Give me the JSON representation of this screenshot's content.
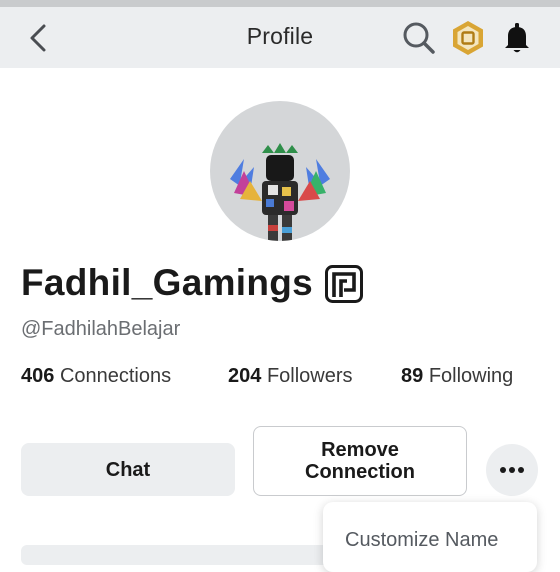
{
  "header": {
    "title": "Profile",
    "back_icon": "chevron-left-icon",
    "search_icon": "search-icon",
    "currency_icon": "robux-currency-icon",
    "notification_icon": "bell-icon"
  },
  "profile": {
    "display_name": "Fadhil_Gamings",
    "badge_icon": "verified-badge-icon",
    "username": "@FadhilahBelajar",
    "stats": [
      {
        "count": "406",
        "label": "Connections"
      },
      {
        "count": "204",
        "label": "Followers"
      },
      {
        "count": "89",
        "label": "Following"
      }
    ]
  },
  "actions": {
    "chat_label": "Chat",
    "remove_label": "Remove Connection",
    "more_icon": "more-dots-icon"
  },
  "menu": {
    "items": [
      "Customize Name"
    ]
  },
  "colors": {
    "header_bg": "#eceef0",
    "button_bg": "#eceef0",
    "text_primary": "#1a1a1a",
    "text_secondary": "#6b6e72",
    "coin_gold": "#d9a534"
  }
}
